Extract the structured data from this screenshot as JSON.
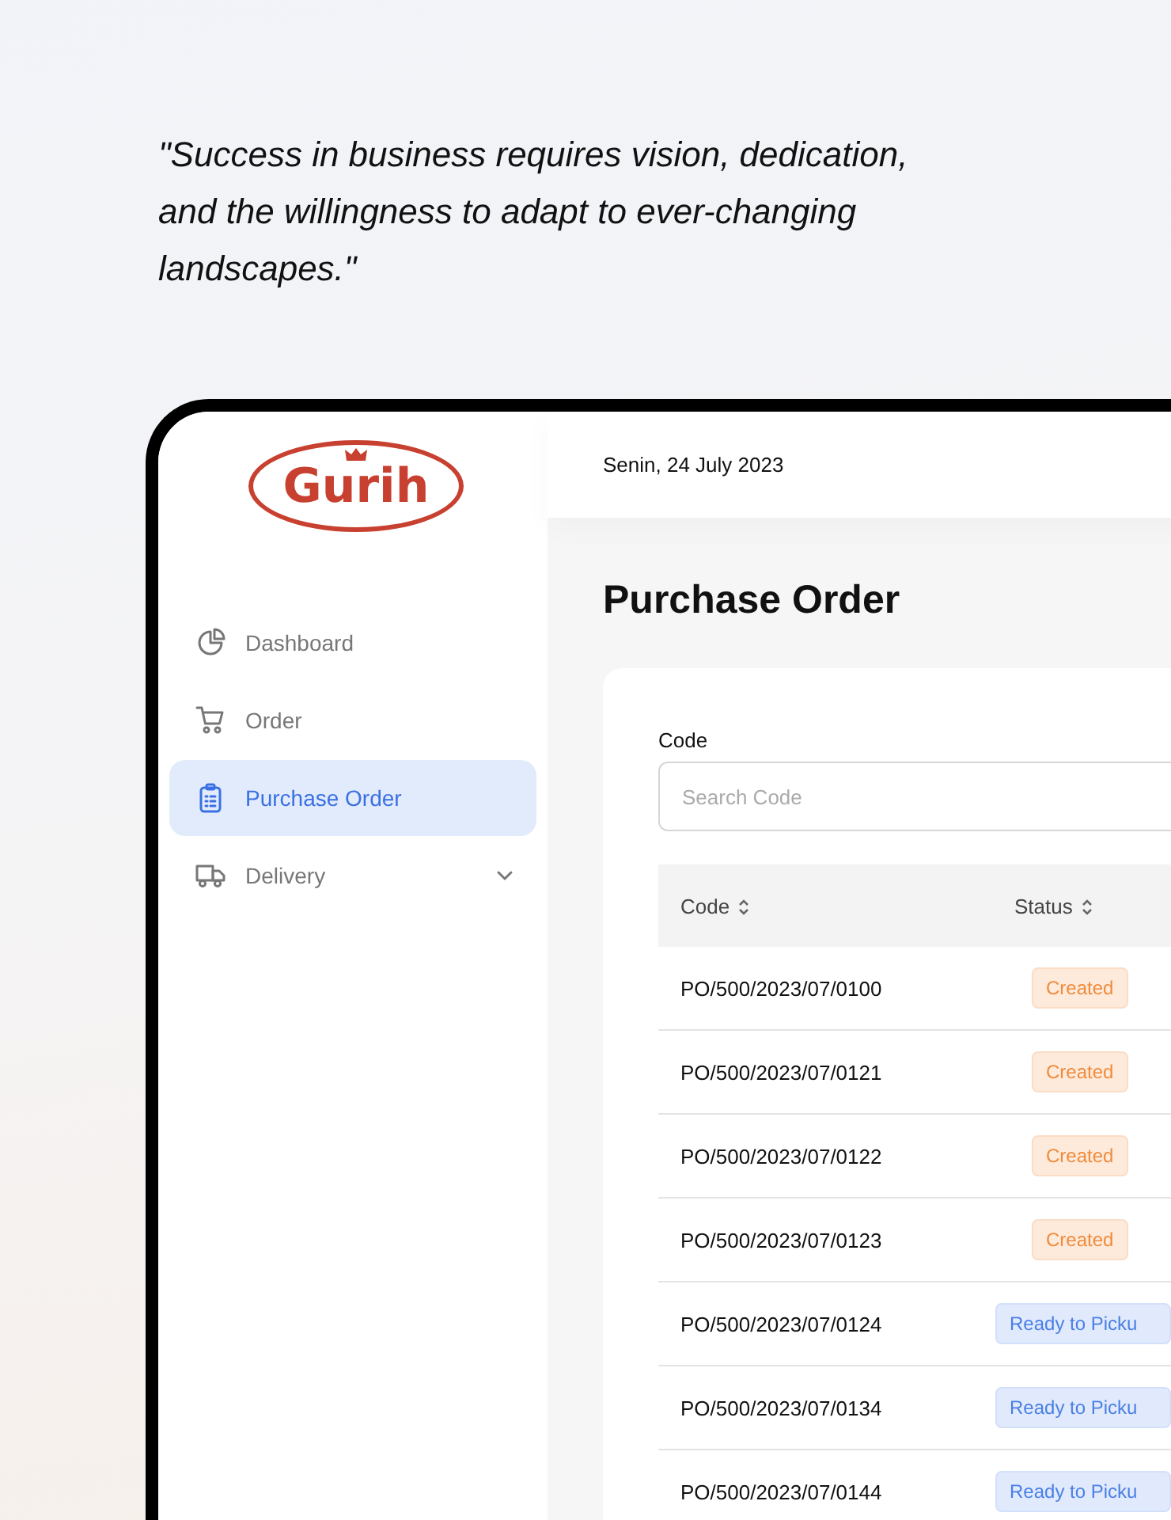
{
  "quote": "\"Success in business requires vision, dedication, and the willingness to adapt to ever-changing landscapes.\"",
  "sidebar": {
    "logo": {
      "text": "Gurih"
    },
    "items": [
      {
        "label": "Dashboard",
        "selected": false,
        "expandable": false
      },
      {
        "label": "Order",
        "selected": false,
        "expandable": false
      },
      {
        "label": "Purchase Order",
        "selected": true,
        "expandable": false
      },
      {
        "label": "Delivery",
        "selected": false,
        "expandable": true
      }
    ]
  },
  "header": {
    "date": "Senin, 24 July 2023"
  },
  "page_title": "Purchase Order",
  "filter": {
    "label": "Code",
    "placeholder": "Search Code"
  },
  "table": {
    "columns": [
      "Code",
      "Status"
    ],
    "rows": [
      {
        "code": "PO/500/2023/07/0100",
        "status": "Created",
        "kind": "created"
      },
      {
        "code": "PO/500/2023/07/0121",
        "status": "Created",
        "kind": "created"
      },
      {
        "code": "PO/500/2023/07/0122",
        "status": "Created",
        "kind": "created"
      },
      {
        "code": "PO/500/2023/07/0123",
        "status": "Created",
        "kind": "created"
      },
      {
        "code": "PO/500/2023/07/0124",
        "status": "Ready to Picku",
        "kind": "ready"
      },
      {
        "code": "PO/500/2023/07/0134",
        "status": "Ready to Picku",
        "kind": "ready"
      },
      {
        "code": "PO/500/2023/07/0144",
        "status": "Ready to Picku",
        "kind": "ready"
      }
    ]
  }
}
